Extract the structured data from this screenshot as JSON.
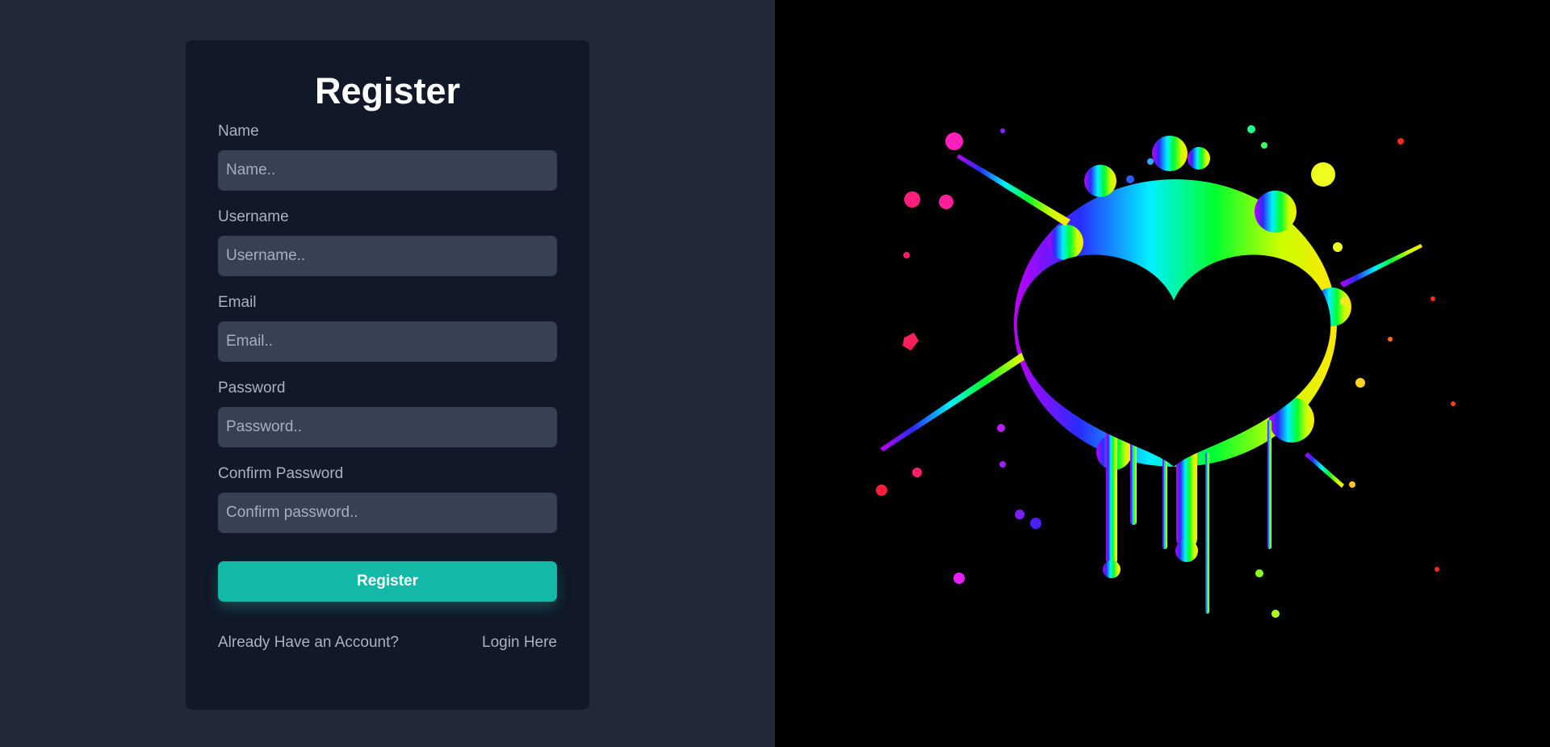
{
  "form": {
    "title": "Register",
    "fields": [
      {
        "label": "Name",
        "placeholder": "Name..",
        "value": ""
      },
      {
        "label": "Username",
        "placeholder": "Username..",
        "value": ""
      },
      {
        "label": "Email",
        "placeholder": "Email..",
        "value": ""
      },
      {
        "label": "Password",
        "placeholder": "Password..",
        "value": ""
      },
      {
        "label": "Confirm Password",
        "placeholder": "Confirm password..",
        "value": ""
      }
    ],
    "submit_label": "Register",
    "footer_text": "Already Have an Account?",
    "login_link_label": "Login Here"
  },
  "illustration": {
    "icon": "rainbow-splatter-heart",
    "background_color": "#000000"
  },
  "colors": {
    "page_background": "#212836",
    "card_background": "#111827",
    "input_background": "#374151",
    "accent": "#14b8a6"
  }
}
